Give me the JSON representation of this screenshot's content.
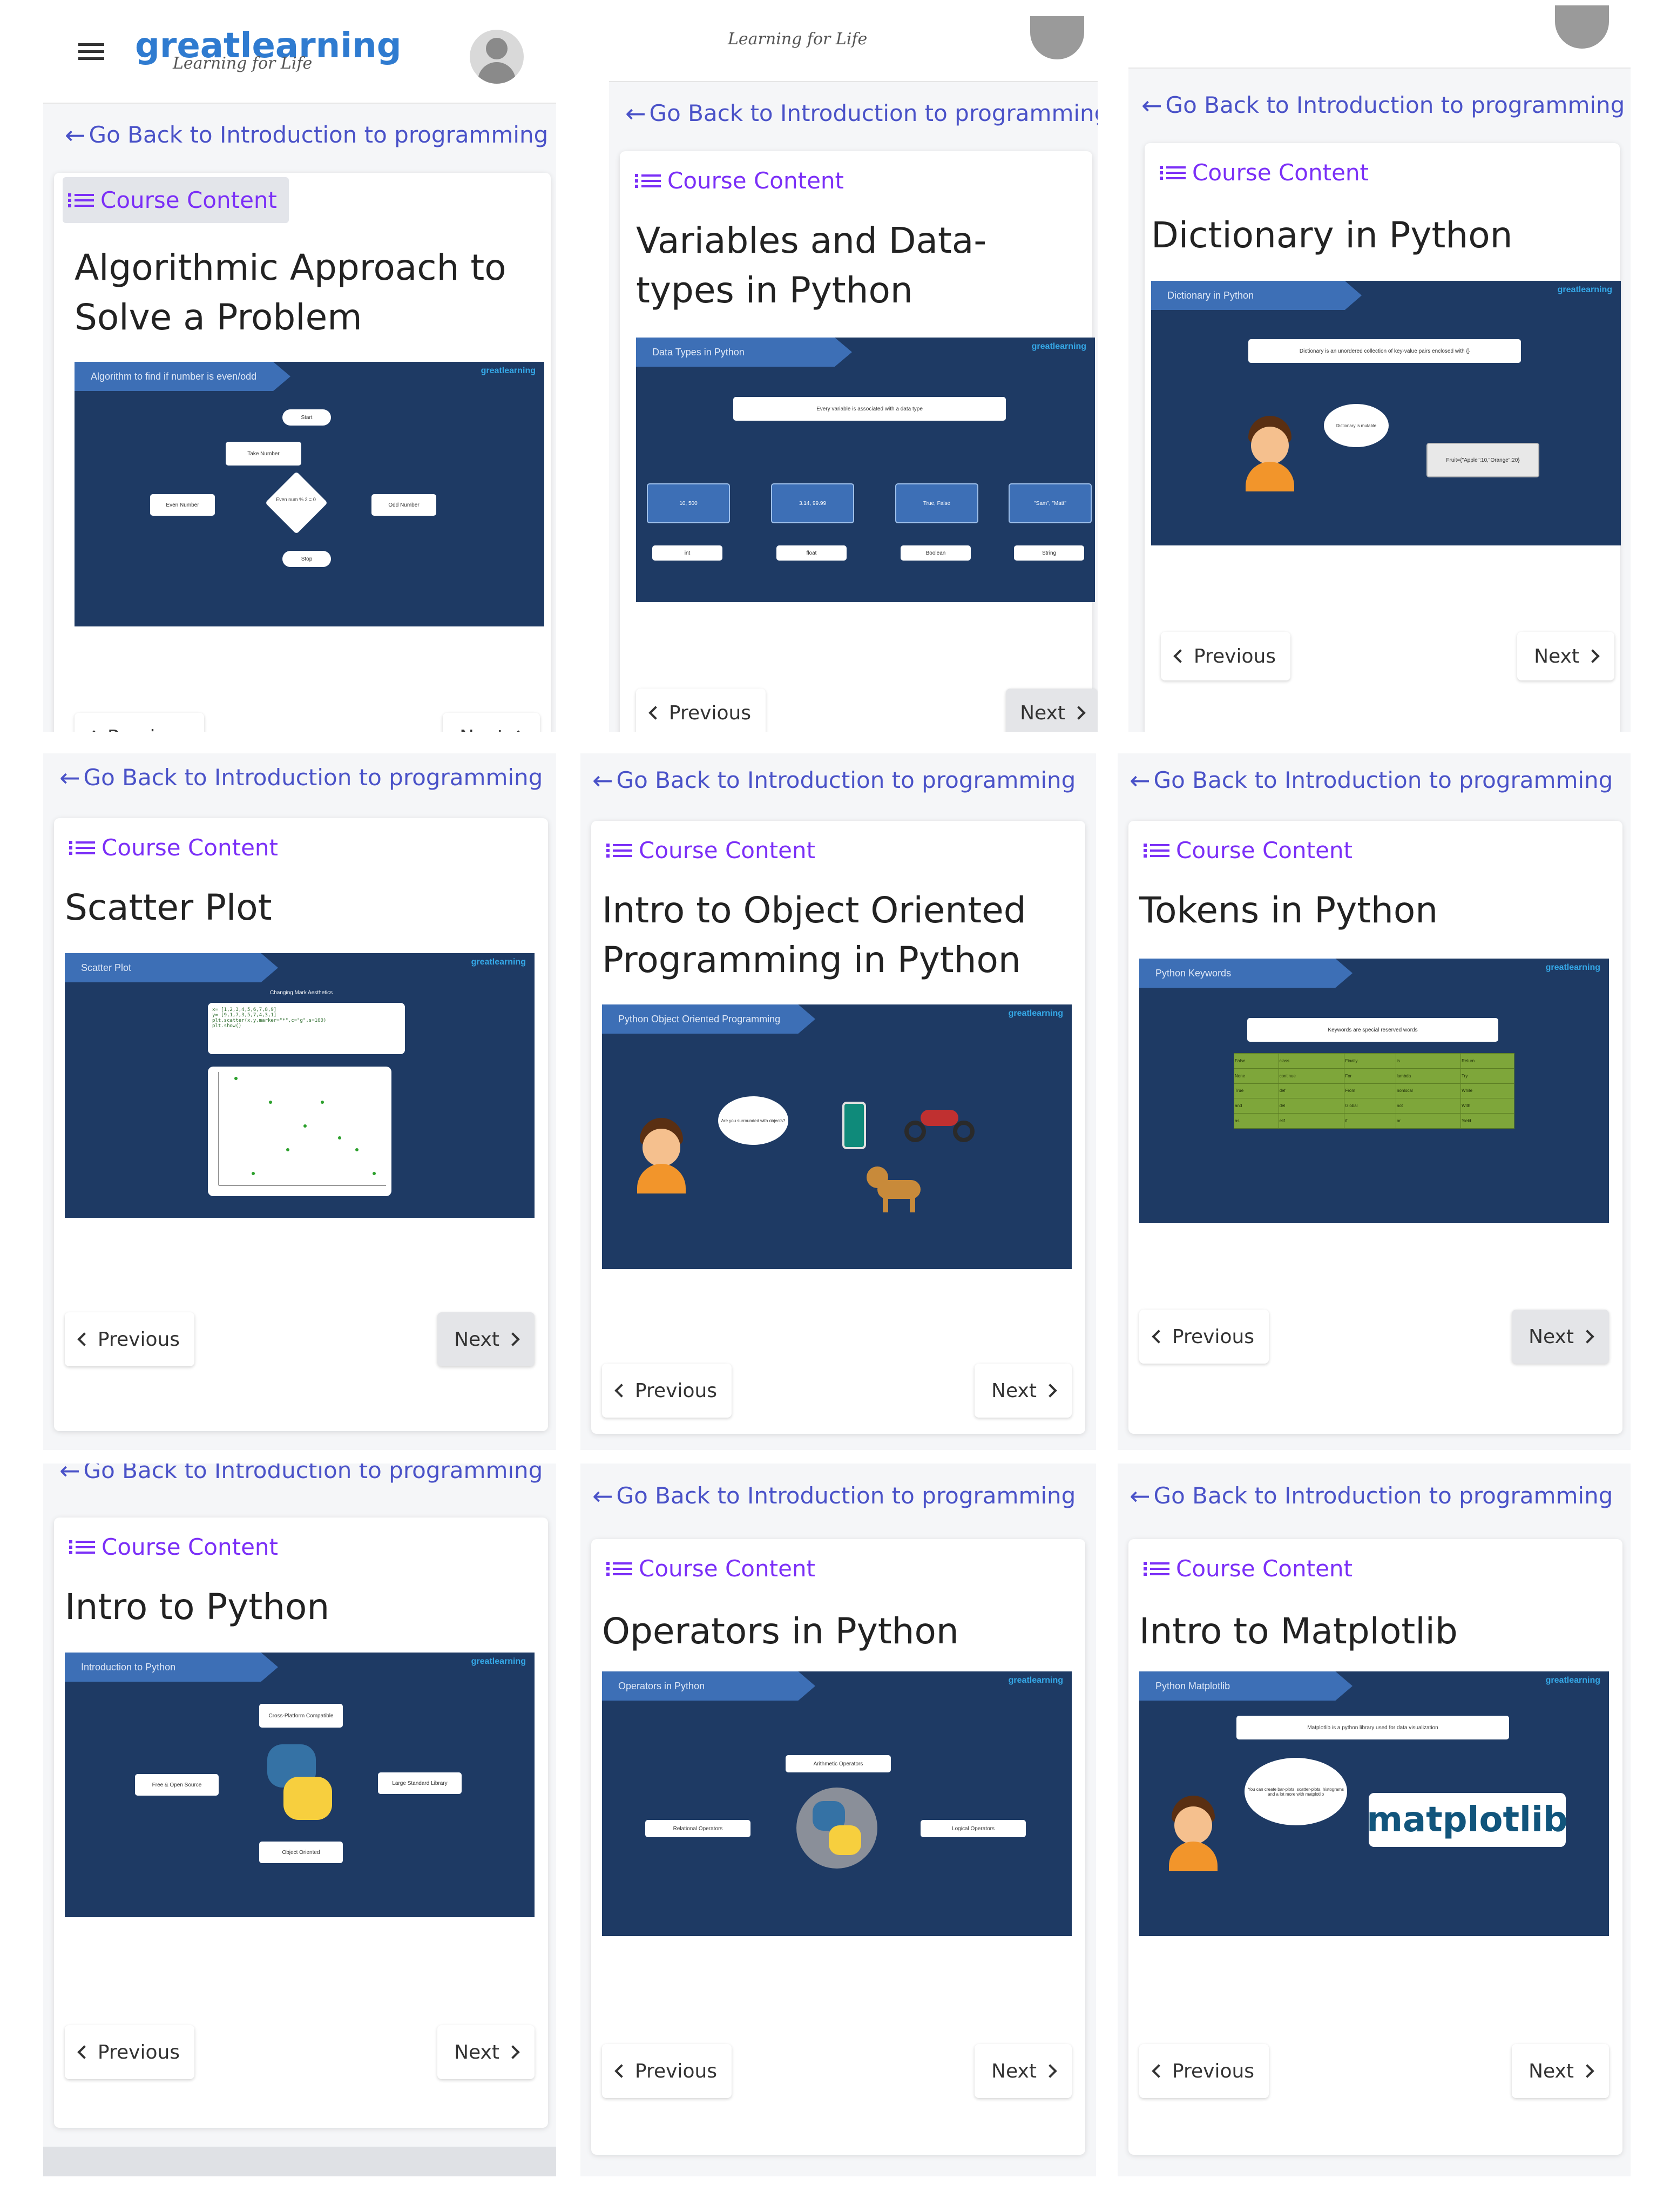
{
  "header": {
    "logo": "greatlearning",
    "tagline": "Learning for Life"
  },
  "common": {
    "back_label": "Go Back to Introduction to programming",
    "course_content": "Course Content",
    "previous": "Previous",
    "next": "Next",
    "brand": "greatlearning"
  },
  "panels": [
    {
      "title": "Algorithmic Approach to Solve a Problem",
      "slide_heading": "Algorithm to find if number is even/odd",
      "slide_items": [
        "Start",
        "Take Number",
        "Even num % 2 = 0",
        "Even Number",
        "Odd Number",
        "Stop"
      ]
    },
    {
      "title": "Variables and Data-types in Python",
      "slide_heading": "Data Types in Python",
      "slide_items": [
        "Every variable is associated with a data type",
        "10, 500",
        "3.14, 99.99",
        "True, False",
        "\"Sam\", \"Matt\"",
        "int",
        "float",
        "Boolean",
        "String"
      ]
    },
    {
      "title": "Dictionary in Python",
      "slide_heading": "Dictionary in Python",
      "slide_items": [
        "Dictionary is an unordered collection of key-value pairs enclosed with {}",
        "Dictionary is mutable",
        "Fruit={\"Apple\":10,\"Orange\":20}"
      ]
    },
    {
      "title": "Scatter Plot",
      "slide_heading": "Scatter Plot",
      "slide_items": [
        "Changing Mark Aesthetics",
        "x= [1,2,3,4,5,6,7,8,9]",
        "y= [9,1,7,3,5,7,4,3,1]",
        "plt.scatter(x,y,marker=\"*\",c=\"g\",s=100)",
        "plt.show()"
      ]
    },
    {
      "title": "Intro to Object Oriented Programming in Python",
      "slide_heading": "Python Object Oriented Programming",
      "slide_items": [
        "Are you surrounded with objects?"
      ]
    },
    {
      "title": "Tokens in Python",
      "slide_heading": "Python Keywords",
      "slide_items": [
        "Keywords are special reserved words"
      ],
      "keywords": [
        [
          "False",
          "class",
          "Finally",
          "is",
          "Return"
        ],
        [
          "None",
          "continue",
          "For",
          "lambda",
          "Try"
        ],
        [
          "True",
          "def",
          "From",
          "nonlocal",
          "While"
        ],
        [
          "and",
          "del",
          "Global",
          "not",
          "With"
        ],
        [
          "as",
          "elif",
          "if",
          "or",
          "Yield"
        ]
      ]
    },
    {
      "title": "Intro to Python",
      "slide_heading": "Introduction to Python",
      "slide_items": [
        "Cross-Platform Compatible",
        "Free & Open Source",
        "Large Standard Library",
        "Object Oriented"
      ]
    },
    {
      "title": "Operators in Python",
      "slide_heading": "Operators in Python",
      "slide_items": [
        "Arithmetic Operators",
        "Relational Operators",
        "Logical Operators"
      ]
    },
    {
      "title": "Intro to Matplotlib",
      "slide_heading": "Python Matplotlib",
      "slide_items": [
        "Matplotlib is a python library used for data visualization",
        "You can create bar-plots, scatter-plots, histograms and a lot more with matplotlib",
        "matplotlib"
      ]
    }
  ]
}
